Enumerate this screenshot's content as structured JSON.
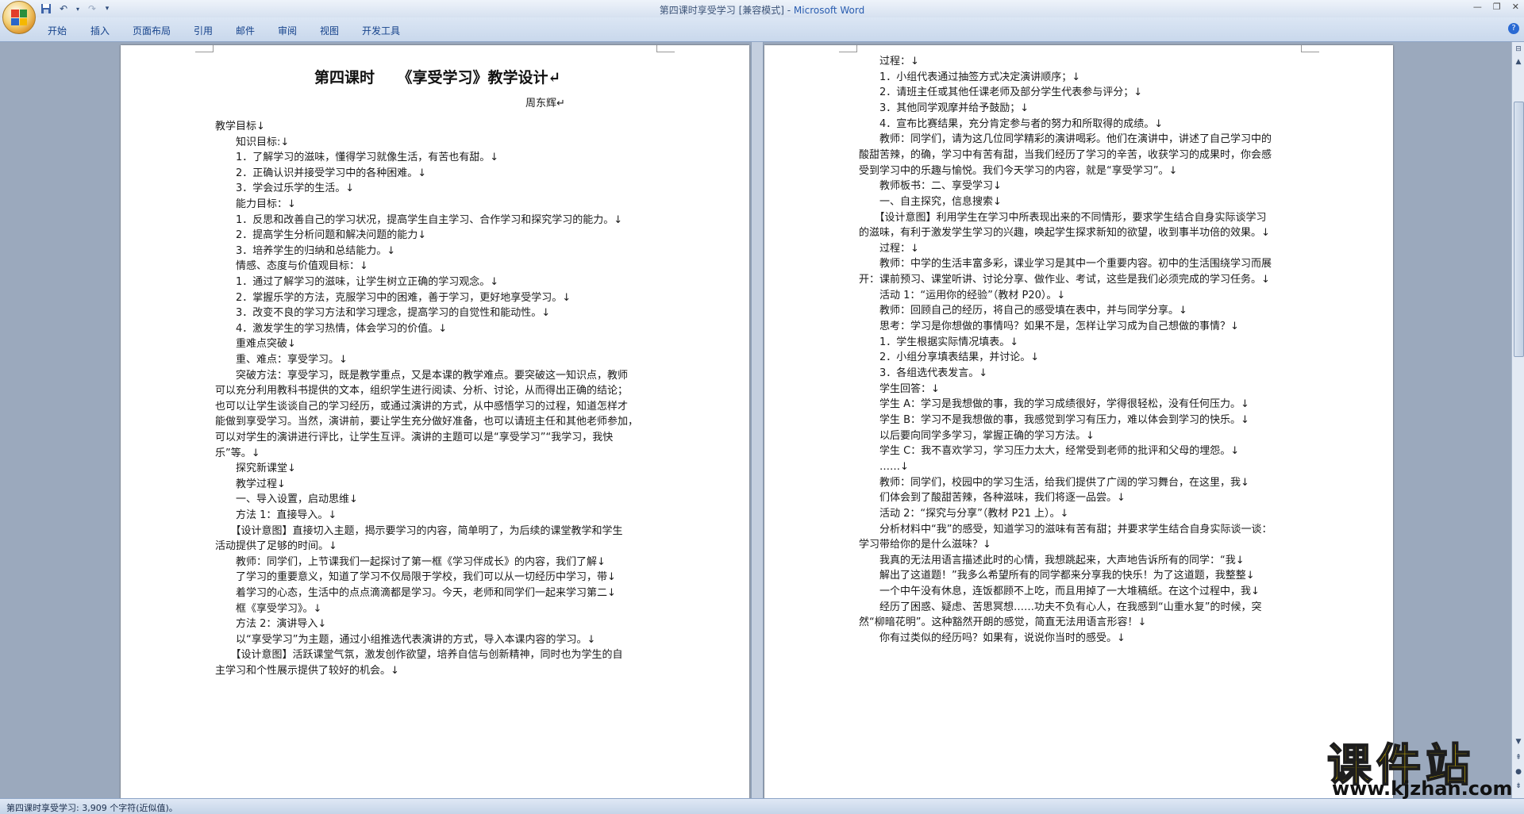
{
  "window": {
    "title_doc": "第四课时享受学习 [兼容模式] - ",
    "title_app": "Microsoft Word"
  },
  "ribbon": {
    "tabs": [
      "开始",
      "插入",
      "页面布局",
      "引用",
      "邮件",
      "审阅",
      "视图",
      "开发工具"
    ]
  },
  "left_page": {
    "title": "第四课时　　《享受学习》教学设计↵",
    "author": "周东辉↵",
    "lines": [
      "教学目标↓",
      "　　知识目标:↓",
      "　　1．了解学习的滋味，懂得学习就像生活，有苦也有甜。↓",
      "　　2．正确认识并接受学习中的各种困难。↓",
      "　　3．学会过乐学的生活。↓",
      "　　能力目标：↓",
      "　　1．反思和改善自己的学习状况，提高学生自主学习、合作学习和探究学习的能力。↓",
      "　　2．提高学生分析问题和解决问题的能力↓",
      "　　3．培养学生的归纳和总结能力。↓",
      "　　情感、态度与价值观目标：↓",
      "　　1．通过了解学习的滋味，让学生树立正确的学习观念。↓",
      "　　2．掌握乐学的方法，克服学习中的困难，善于学习，更好地享受学习。↓",
      "　　3．改变不良的学习方法和学习理念，提高学习的自觉性和能动性。↓",
      "　　4．激发学生的学习热情，体会学习的价值。↓",
      "　　重难点突破↓",
      "　　重、难点：享受学习。↓",
      "　　突破方法：享受学习，既是教学重点，又是本课的教学难点。要突破这一知识点，教师",
      "可以充分利用教科书提供的文本，组织学生进行阅读、分析、讨论，从而得出正确的结论；",
      "也可以让学生谈谈自己的学习经历，或通过演讲的方式，从中感悟学习的过程，知道怎样才",
      "能做到享受学习。当然，演讲前，要让学生充分做好准备，也可以请班主任和其他老师参加，",
      "可以对学生的演讲进行评比，让学生互评。演讲的主题可以是“享受学习”“我学习，我快",
      "乐”等。↓",
      "　　探究新课堂↓",
      "　　教学过程↓",
      "　　一、导入设置，启动思维↓",
      "　　方法 1：直接导入。↓",
      "　　【设计意图】直接切入主题，揭示要学习的内容，简单明了，为后续的课堂教学和学生",
      "活动提供了足够的时间。↓",
      "　　教师：同学们，上节课我们一起探讨了第一框《学习伴成长》的内容，我们了解↓",
      "　　了学习的重要意义，知道了学习不仅局限于学校，我们可以从一切经历中学习，带↓",
      "　　着学习的心态，生活中的点点滴滴都是学习。今天，老师和同学们一起来学习第二↓",
      "　　框《享受学习》。↓",
      "　　方法 2：演讲导入↓",
      "　　以“享受学习”为主题，通过小组推选代表演讲的方式，导入本课内容的学习。↓",
      "　　【设计意图】活跃课堂气氛，激发创作欲望，培养自信与创新精神，同时也为学生的自",
      "主学习和个性展示提供了较好的机会。↓"
    ]
  },
  "right_page": {
    "lines": [
      "　　过程：↓",
      "　　1．小组代表通过抽签方式决定演讲顺序；↓",
      "　　2．请班主任或其他任课老师及部分学生代表参与评分；↓",
      "　　3．其他同学观摩并给予鼓励；↓",
      "　　4．宣布比赛结果，充分肯定参与者的努力和所取得的成绩。↓",
      "　　教师：同学们，请为这几位同学精彩的演讲喝彩。他们在演讲中，讲述了自己学习中的",
      "酸甜苦辣，的确，学习中有苦有甜，当我们经历了学习的辛苦，收获学习的成果时，你会感",
      "受到学习中的乐趣与愉悦。我们今天学习的内容，就是“享受学习”。↓",
      "　　教师板书：二、享受学习↓",
      "　　一、自主探究，信息搜索↓",
      "　　【设计意图】利用学生在学习中所表现出来的不同情形，要求学生结合自身实际谈学习",
      "的滋味，有利于激发学生学习的兴趣，唤起学生探求新知的欲望，收到事半功倍的效果。↓",
      "　　过程：↓",
      "　　教师：中学的生活丰富多彩，课业学习是其中一个重要内容。初中的生活围绕学习而展",
      "开：课前预习、课堂听讲、讨论分享、做作业、考试，这些是我们必须完成的学习任务。↓",
      "　　活动 1：“运用你的经验”（教材 P20）。↓",
      "　　教师：回顾自己的经历，将自己的感受填在表中，并与同学分享。↓",
      "　　思考：学习是你想做的事情吗？如果不是，怎样让学习成为自己想做的事情？↓",
      "　　1．学生根据实际情况填表。↓",
      "　　2．小组分享填表结果，并讨论。↓",
      "　　3．各组选代表发言。↓",
      "　　学生回答：↓",
      "　　学生 A：学习是我想做的事，我的学习成绩很好，学得很轻松，没有任何压力。↓",
      "　　学生 B：学习不是我想做的事，我感觉到学习有压力，难以体会到学习的快乐。↓",
      "　　以后要向同学多学习，掌握正确的学习方法。↓",
      "　　学生 C：我不喜欢学习，学习压力太大，经常受到老师的批评和父母的埋怨。↓",
      "　　……↓",
      "　　教师：同学们，校园中的学习生活，给我们提供了广阔的学习舞台，在这里，我↓",
      "　　们体会到了酸甜苦辣，各种滋味，我们将逐一品尝。↓",
      "　　活动 2：“探究与分享”（教材 P21 上）。↓",
      "　　分析材料中“我”的感受，知道学习的滋味有苦有甜；并要求学生结合自身实际谈一谈：",
      "学习带给你的是什么滋味？↓",
      "　　我真的无法用语言描述此时的心情，我想跳起来，大声地告诉所有的同学：“我↓",
      "　　解出了这道题！”我多么希望所有的同学都来分享我的快乐！为了这道题，我整整↓",
      "　　一个中午没有休息，连饭都顾不上吃，而且用掉了一大堆稿纸。在这个过程中，我↓",
      "　　经历了困惑、疑虑、苦思冥想……功夫不负有心人，在我感到“山重水复”的时候，突",
      "然“柳暗花明”。这种豁然开朗的感觉，简直无法用语言形容！↓",
      "　　你有过类似的经历吗？如果有，说说你当时的感受。↓"
    ]
  },
  "status": {
    "text": "第四课时享受学习: 3,909 个字符(近似值)。"
  },
  "watermark": {
    "brand": "课件站",
    "url": "www.kjzhan.com"
  }
}
